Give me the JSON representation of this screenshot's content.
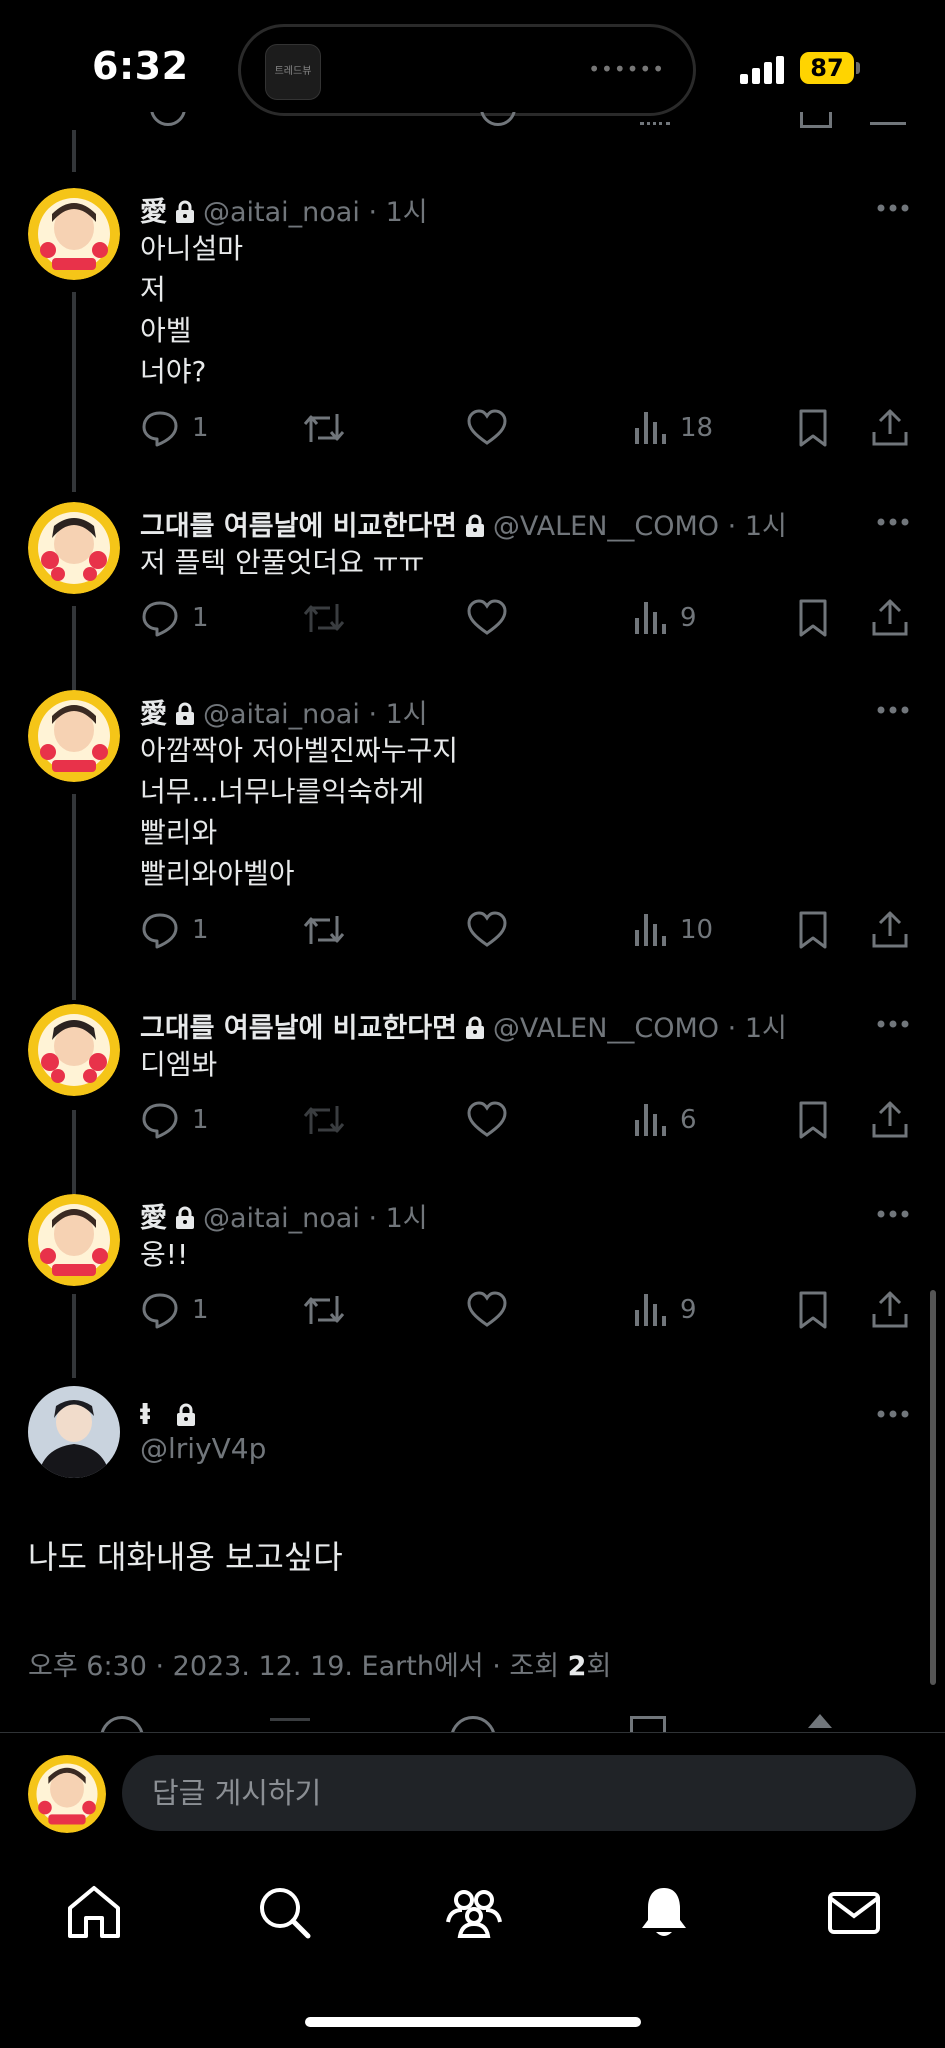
{
  "status_bar": {
    "time": "6:32",
    "battery": "87",
    "island_app_label": "트레드뷰"
  },
  "tweets": [
    {
      "name": "愛",
      "handle": "@aitai_noai",
      "time": "1시",
      "lines": [
        "아니설마",
        "저",
        "아벨",
        "너야?"
      ],
      "replies": "1",
      "views": "18",
      "retweet_enabled": true
    },
    {
      "name": "그대를 여름날에 비교한다면",
      "handle": "@VALEN__COMO",
      "time": "1시",
      "lines": [
        "저 플텍 안풀엇더요 ㅠㅠ"
      ],
      "replies": "1",
      "views": "9",
      "retweet_enabled": false
    },
    {
      "name": "愛",
      "handle": "@aitai_noai",
      "time": "1시",
      "lines": [
        "아깜짝아 저아벨진짜누구지",
        "너무...너무나를익숙하게",
        "빨리와",
        "빨리와아벨아"
      ],
      "replies": "1",
      "views": "10",
      "retweet_enabled": true
    },
    {
      "name": "그대를 여름날에 비교한다면",
      "handle": "@VALEN__COMO",
      "time": "1시",
      "lines": [
        "디엠봐"
      ],
      "replies": "1",
      "views": "6",
      "retweet_enabled": false
    },
    {
      "name": "愛",
      "handle": "@aitai_noai",
      "time": "1시",
      "lines": [
        "웅!!"
      ],
      "replies": "1",
      "views": "9",
      "retweet_enabled": true
    }
  ],
  "main_tweet": {
    "name": "ⱡ",
    "handle": "@lriyV4p",
    "text": "나도 대화내용 보고싶다",
    "meta_prefix": "오후 6:30 · 2023. 12. 19. Earth에서 · 조회 ",
    "view_count": "2",
    "meta_suffix": "회"
  },
  "reply_bar": {
    "placeholder": "답글 게시하기"
  },
  "icons": {
    "reply": "reply-icon",
    "retweet": "retweet-icon",
    "like": "heart-icon",
    "views": "views-icon",
    "bookmark": "bookmark-icon",
    "share": "share-icon",
    "more": "more-icon",
    "lock": "lock-icon"
  },
  "colors": {
    "background": "#000000",
    "text": "#e7e9ea",
    "secondary": "#71767b",
    "avatar_ring": "#f5c518",
    "battery": "#ffd400"
  }
}
